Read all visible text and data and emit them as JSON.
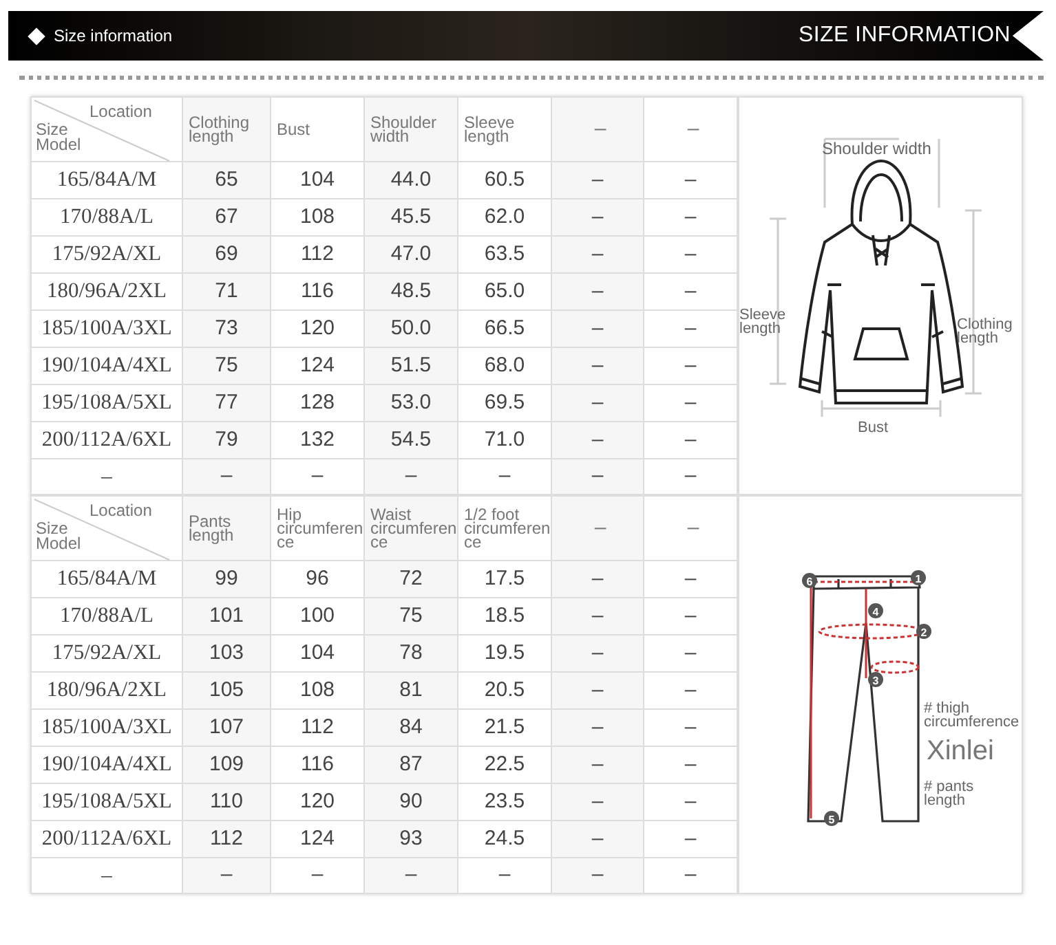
{
  "banner": {
    "title": "Size information",
    "title_right": "SIZE INFORMATION"
  },
  "sections": [
    {
      "header": {
        "location": "Location",
        "size": "Size",
        "model": "Model",
        "columns": [
          "Clothing length",
          "Bust",
          "Shoulder width",
          "Sleeve length",
          "–",
          "–"
        ]
      },
      "rows": [
        [
          "165/84A/M",
          "65",
          "104",
          "44.0",
          "60.5",
          "–",
          "–"
        ],
        [
          "170/88A/L",
          "67",
          "108",
          "45.5",
          "62.0",
          "–",
          "–"
        ],
        [
          "175/92A/XL",
          "69",
          "112",
          "47.0",
          "63.5",
          "–",
          "–"
        ],
        [
          "180/96A/2XL",
          "71",
          "116",
          "48.5",
          "65.0",
          "–",
          "–"
        ],
        [
          "185/100A/3XL",
          "73",
          "120",
          "50.0",
          "66.5",
          "–",
          "–"
        ],
        [
          "190/104A/4XL",
          "75",
          "124",
          "51.5",
          "68.0",
          "–",
          "–"
        ],
        [
          "195/108A/5XL",
          "77",
          "128",
          "53.0",
          "69.5",
          "–",
          "–"
        ],
        [
          "200/112A/6XL",
          "79",
          "132",
          "54.5",
          "71.0",
          "–",
          "–"
        ],
        [
          "–",
          "–",
          "–",
          "–",
          "–",
          "–",
          "–"
        ]
      ],
      "figure": {
        "kind": "hoodie",
        "labels": [
          "Shoulder width",
          "Sleeve length",
          "Clothing length",
          "Bust"
        ]
      }
    },
    {
      "header": {
        "location": "Location",
        "size": "Size",
        "model": "Model",
        "columns": [
          "Pants length",
          "Hip circumference",
          "Waist circumference",
          "1/2 foot circumference",
          "–",
          "–"
        ]
      },
      "rows": [
        [
          "165/84A/M",
          "99",
          "96",
          "72",
          "17.5",
          "–",
          "–"
        ],
        [
          "170/88A/L",
          "101",
          "100",
          "75",
          "18.5",
          "–",
          "–"
        ],
        [
          "175/92A/XL",
          "103",
          "104",
          "78",
          "19.5",
          "–",
          "–"
        ],
        [
          "180/96A/2XL",
          "105",
          "108",
          "81",
          "20.5",
          "–",
          "–"
        ],
        [
          "185/100A/3XL",
          "107",
          "112",
          "84",
          "21.5",
          "–",
          "–"
        ],
        [
          "190/104A/4XL",
          "109",
          "116",
          "87",
          "22.5",
          "–",
          "–"
        ],
        [
          "195/108A/5XL",
          "110",
          "120",
          "90",
          "23.5",
          "–",
          "–"
        ],
        [
          "200/112A/6XL",
          "112",
          "124",
          "93",
          "24.5",
          "–",
          "–"
        ],
        [
          "–",
          "–",
          "–",
          "–",
          "–",
          "–",
          "–"
        ]
      ],
      "figure": {
        "kind": "pants",
        "labels": [
          "# thigh circumference",
          "Xinlei",
          "# pants length"
        ],
        "markers": [
          "1",
          "2",
          "3",
          "4",
          "5",
          "6"
        ]
      }
    }
  ]
}
